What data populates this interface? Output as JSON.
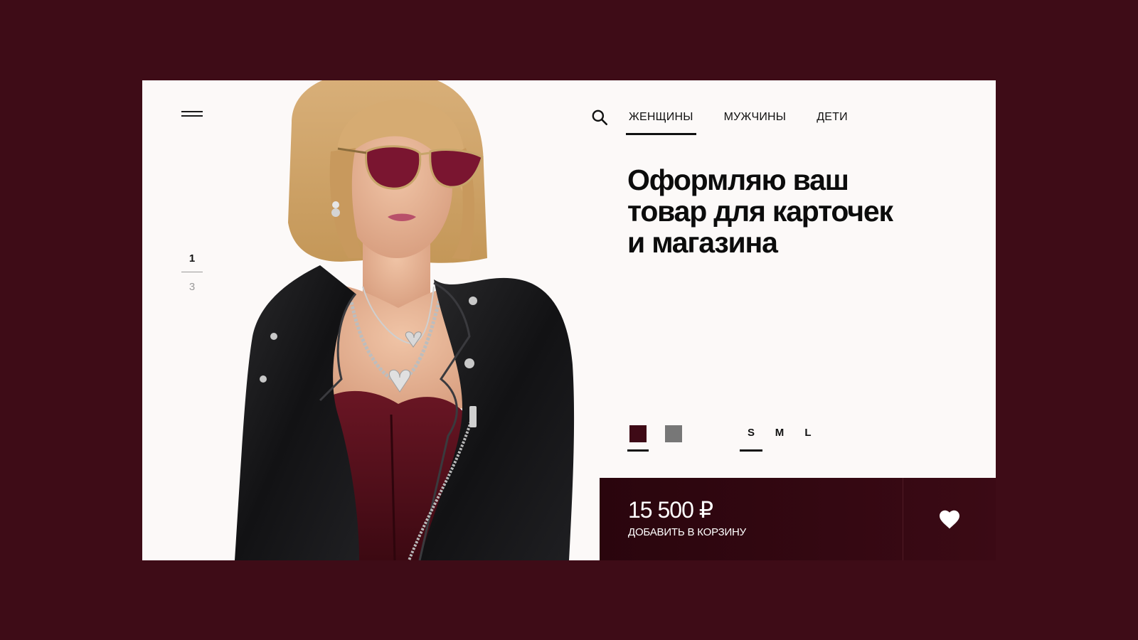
{
  "nav": {
    "items": [
      {
        "label": "ЖЕНЩИНЫ",
        "active": true
      },
      {
        "label": "МУЖЧИНЫ",
        "active": false
      },
      {
        "label": "ДЕТИ",
        "active": false
      }
    ]
  },
  "pager": {
    "current": "1",
    "total": "3"
  },
  "headline": {
    "line1": "Оформляю ваш",
    "line2": "товар для карточек",
    "line3": "и магазина"
  },
  "colors": [
    {
      "name": "burgundy",
      "hex": "#3e0a16",
      "active": true
    },
    {
      "name": "grey",
      "hex": "#777777",
      "active": false
    }
  ],
  "sizes": [
    {
      "label": "S",
      "active": true
    },
    {
      "label": "M",
      "active": false
    },
    {
      "label": "L",
      "active": false
    }
  ],
  "buy": {
    "price": "15 500 ₽",
    "add_to_cart": "ДОБАВИТЬ В КОРЗИНУ"
  },
  "icons": {
    "menu": "hamburger-menu-icon",
    "search": "search-icon",
    "favorite": "heart-icon"
  },
  "theme": {
    "background": "#3e0c17",
    "card": "#fcf9f8",
    "accent": "#2a050d"
  }
}
